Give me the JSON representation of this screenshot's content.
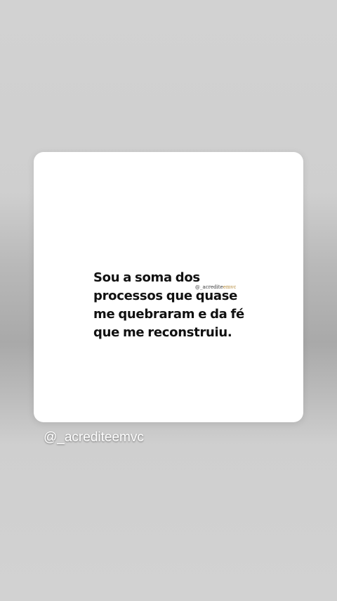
{
  "story": {
    "quote_lines": [
      "Sou a soma dos",
      "processos que quase",
      "me quebraram e da fé",
      "que me reconstruiu."
    ],
    "watermark": {
      "prefix": "@_acredite",
      "accent": "emvc"
    },
    "caption": "@_acrediteemvc"
  },
  "colors": {
    "card": "#ffffff",
    "text": "#111111",
    "caption": "#ffffff",
    "watermark_accent": "#b58a3a"
  }
}
